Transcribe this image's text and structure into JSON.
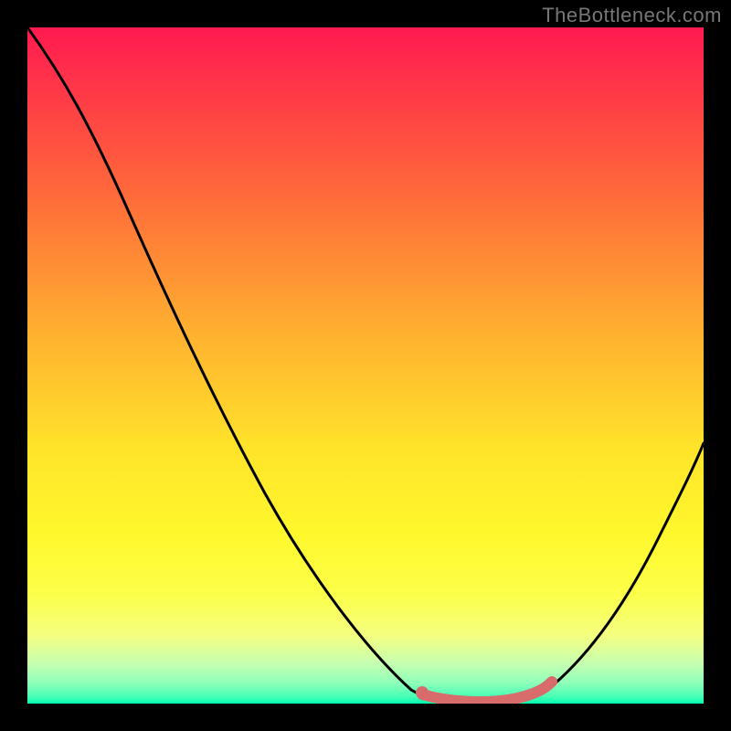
{
  "attribution": "TheBottleneck.com",
  "chart_data": {
    "type": "line",
    "title": "",
    "xlabel": "",
    "ylabel": "",
    "xlim": [
      0,
      1
    ],
    "ylim": [
      0,
      1
    ],
    "grid": false,
    "series": [
      {
        "name": "bottleneck-curve",
        "color": "#000000",
        "x": [
          0.0,
          0.03,
          0.07,
          0.12,
          0.18,
          0.25,
          0.33,
          0.4,
          0.47,
          0.53,
          0.58,
          0.62,
          0.66,
          0.72,
          0.78,
          0.84,
          0.9,
          0.95,
          1.0
        ],
        "y": [
          1.0,
          0.96,
          0.9,
          0.82,
          0.72,
          0.6,
          0.46,
          0.34,
          0.22,
          0.12,
          0.05,
          0.01,
          0.0,
          0.0,
          0.02,
          0.07,
          0.15,
          0.25,
          0.38
        ]
      },
      {
        "name": "highlight-segment",
        "color": "#d86c6c",
        "x": [
          0.58,
          0.61,
          0.64,
          0.67,
          0.7,
          0.73,
          0.76
        ],
        "y": [
          0.015,
          0.01,
          0.005,
          0.005,
          0.005,
          0.01,
          0.02
        ]
      }
    ],
    "markers": [
      {
        "name": "optimum-point",
        "x": 0.58,
        "y": 0.018,
        "color": "#d86c6c"
      }
    ],
    "gradient_stops": [
      {
        "pos": 0.0,
        "color": "#ff1a50"
      },
      {
        "pos": 0.25,
        "color": "#ff6b3a"
      },
      {
        "pos": 0.62,
        "color": "#ffe32a"
      },
      {
        "pos": 0.9,
        "color": "#f4ff81"
      },
      {
        "pos": 1.0,
        "color": "#00ffb0"
      }
    ]
  }
}
